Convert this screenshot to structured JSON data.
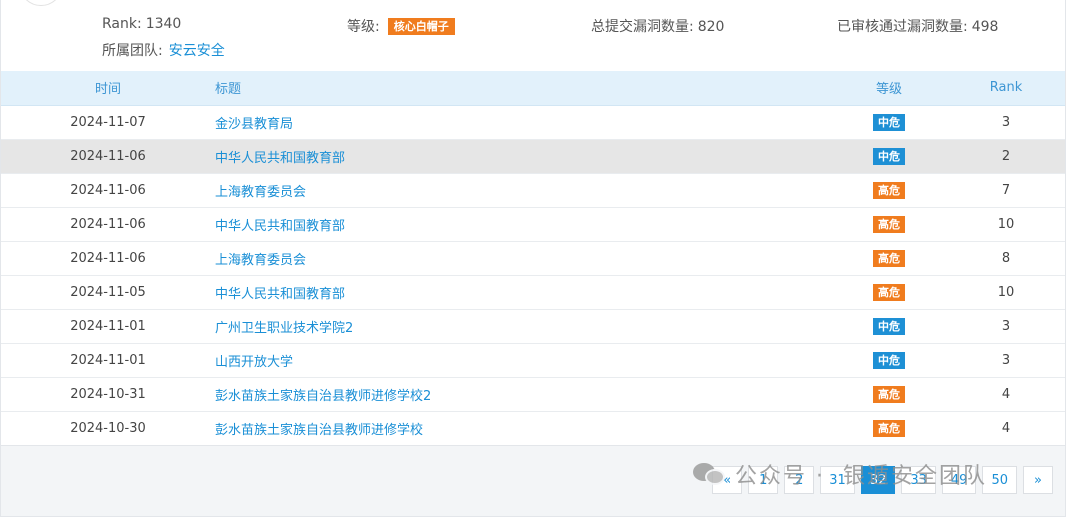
{
  "profile": {
    "rank_label": "Rank:",
    "rank_value": "1340",
    "level_label": "等级:",
    "level_badge": "核心白帽子",
    "total_label": "总提交漏洞数量:",
    "total_value": "820",
    "approved_label": "已审核通过漏洞数量:",
    "approved_value": "498",
    "team_label": "所属团队:",
    "team_name": "安云安全"
  },
  "table": {
    "headers": {
      "time": "时间",
      "title": "标题",
      "level": "等级",
      "rank": "Rank"
    },
    "rows": [
      {
        "time": "2024-11-07",
        "title": "金沙县教育局",
        "level": "中危",
        "rank": "3"
      },
      {
        "time": "2024-11-06",
        "title": "中华人民共和国教育部",
        "level": "中危",
        "rank": "2"
      },
      {
        "time": "2024-11-06",
        "title": "上海教育委员会",
        "level": "高危",
        "rank": "7"
      },
      {
        "time": "2024-11-06",
        "title": "中华人民共和国教育部",
        "level": "高危",
        "rank": "10"
      },
      {
        "time": "2024-11-06",
        "title": "上海教育委员会",
        "level": "高危",
        "rank": "8"
      },
      {
        "time": "2024-11-05",
        "title": "中华人民共和国教育部",
        "level": "高危",
        "rank": "10"
      },
      {
        "time": "2024-11-01",
        "title": "广州卫生职业技术学院2",
        "level": "中危",
        "rank": "3"
      },
      {
        "time": "2024-11-01",
        "title": "山西开放大学",
        "level": "中危",
        "rank": "3"
      },
      {
        "time": "2024-10-31",
        "title": "彭水苗族土家族自治县教师进修学校2",
        "level": "高危",
        "rank": "4"
      },
      {
        "time": "2024-10-30",
        "title": "彭水苗族土家族自治县教师进修学校",
        "level": "高危",
        "rank": "4"
      }
    ]
  },
  "pagination": {
    "prev": "«",
    "pages": [
      "1",
      "2",
      "31",
      "32",
      "33",
      "49",
      "50"
    ],
    "current": "32",
    "next": "»"
  },
  "watermark": {
    "icon": "wechat-icon",
    "prefix": "公众号 ·",
    "name": "银遁安全团队"
  },
  "colors": {
    "link": "#1a8fd6",
    "medium": "#1e90d5",
    "high": "#f07c1e",
    "header_bg": "#e2f1fb"
  }
}
